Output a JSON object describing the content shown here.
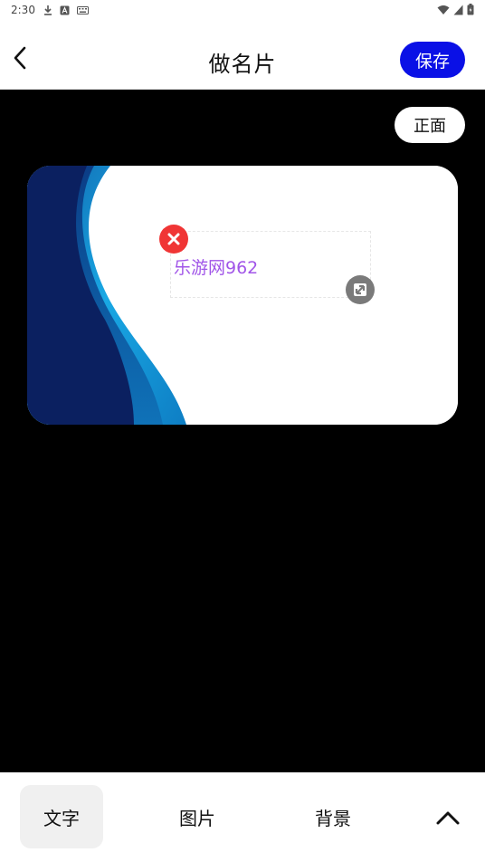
{
  "status_bar": {
    "time": "2:30",
    "left_icons": [
      "download-icon",
      "a-box-icon",
      "keyboard-icon"
    ],
    "right_icons": [
      "wifi-icon",
      "cellular-signal-icon",
      "battery-icon"
    ]
  },
  "header": {
    "title": "做名片",
    "save_label": "保存",
    "back_icon": "chevron-left-icon"
  },
  "canvas": {
    "side_toggle_label": "正面",
    "card": {
      "text": "乐游网962",
      "text_color": "#a155e8",
      "wave_colors": [
        "#0b2060",
        "#0f72b8",
        "#19a8e4"
      ]
    }
  },
  "bottom_tabs": {
    "text_label": "文字",
    "image_label": "图片",
    "background_label": "背景",
    "selected": "文字",
    "expand_icon": "chevron-up-icon"
  },
  "colors": {
    "accent": "#0a10e6",
    "delete": "#f03535",
    "handle": "#7a7a7a"
  }
}
